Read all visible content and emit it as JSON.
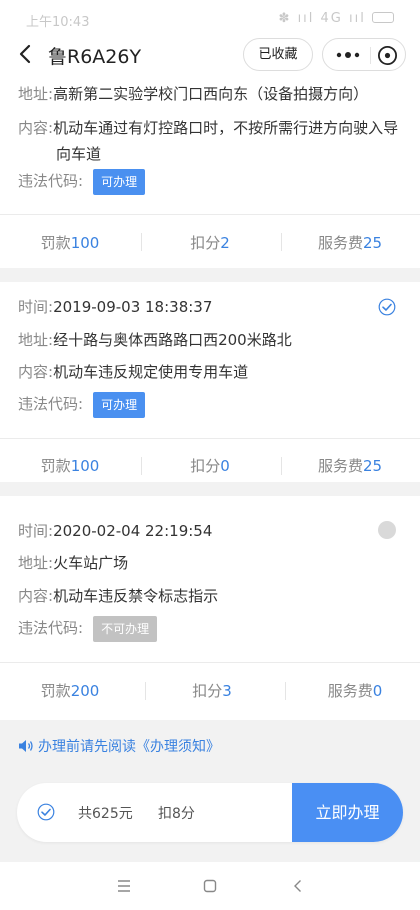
{
  "status": {
    "time": "上午10:43",
    "icons_text": "✽ ııl 4G ııl"
  },
  "header": {
    "title": "鲁R6A26Y",
    "collect_label": "已收藏"
  },
  "violations": [
    {
      "address_label": "地址:",
      "address": "高新第二实验学校门口西向东（设备拍摄方向）",
      "content_label": "内容:",
      "content": "机动车通过有灯控路口时，不按所需行进方向驶入导向车道",
      "code_label": "违法代码:",
      "badge": "可办理",
      "fine_label": "罚款",
      "fine": "100",
      "points_label": "扣分",
      "points": "2",
      "fee_label": "服务费",
      "fee": "25"
    },
    {
      "time_label": "时间:",
      "time": "2019-09-03 18:38:37",
      "address_label": "地址:",
      "address": "经十路与奥体西路路口西200米路北",
      "content_label": "内容:",
      "content": "机动车违反规定使用专用车道",
      "code_label": "违法代码:",
      "badge": "可办理",
      "fine_label": "罚款",
      "fine": "100",
      "points_label": "扣分",
      "points": "0",
      "fee_label": "服务费",
      "fee": "25",
      "selected": true
    },
    {
      "time_label": "时间:",
      "time": "2020-02-04 22:19:54",
      "address_label": "地址:",
      "address": "火车站广场",
      "content_label": "内容:",
      "content": "机动车违反禁令标志指示",
      "code_label": "违法代码:",
      "badge": "不可办理",
      "fine_label": "罚款",
      "fine": "200",
      "points_label": "扣分",
      "points": "3",
      "fee_label": "服务费",
      "fee": "0",
      "selected": false
    }
  ],
  "notice": {
    "prefix": "办理前请先阅读",
    "link": "《办理须知》"
  },
  "footer": {
    "total": "共625元",
    "deduct": "扣8分",
    "pay_label": "立即办理"
  },
  "colors": {
    "accent": "#3a82e0",
    "badge_ok": "#4a90f0",
    "badge_disabled": "#c2c2c2",
    "pay_button": "#4a8ff3"
  },
  "icons": [
    "back-arrow-icon",
    "more-dots-icon",
    "close-circle-icon",
    "check-icon",
    "unchecked-circle-icon",
    "speaker-icon",
    "menu-icon",
    "home-icon",
    "back-nav-icon"
  ]
}
